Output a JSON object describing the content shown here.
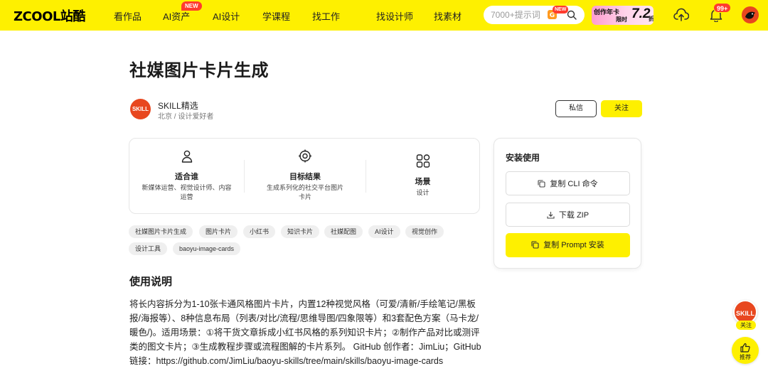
{
  "nav": {
    "logo": "ZCOOL站酷",
    "items": [
      {
        "label": "看作品",
        "badge": ""
      },
      {
        "label": "AI资产",
        "badge": "NEW"
      },
      {
        "label": "AI设计",
        "badge": ""
      },
      {
        "label": "学课程",
        "badge": ""
      },
      {
        "label": "找工作",
        "badge": ""
      },
      {
        "label": "找设计师",
        "badge": ""
      },
      {
        "label": "找素材",
        "badge": ""
      }
    ],
    "search_placeholder": "7000+提示词",
    "search_badge": "NEW",
    "promo": {
      "line1": "创作年卡",
      "line2": "限时",
      "price": "7.2",
      "unit": "折"
    },
    "notification_count": "99+"
  },
  "page": {
    "title": "社媒图片卡片生成"
  },
  "author": {
    "avatar_text": "SKILL",
    "name": "SKILL精选",
    "meta": "北京 / 设计爱好者",
    "dm_label": "私信",
    "follow_label": "关注"
  },
  "info": [
    {
      "icon": "user-icon",
      "label": "适合谁",
      "desc": "新媒体运营、视觉设计师、内容运营"
    },
    {
      "icon": "target-icon",
      "label": "目标结果",
      "desc": "生成系列化的社交平台图片卡片"
    },
    {
      "icon": "grid-icon",
      "label": "场景",
      "desc": "设计"
    }
  ],
  "tags": [
    "社媒图片卡片生成",
    "图片卡片",
    "小红书",
    "知识卡片",
    "社媒配图",
    "AI设计",
    "视觉创作",
    "设计工具",
    "baoyu-image-cards"
  ],
  "usage": {
    "title": "使用说明",
    "text": "将长内容拆分为1-10张卡通风格图片卡片，内置12种视觉风格（可爱/清新/手绘笔记/黑板报/海报等）、8种信息布局（列表/对比/流程/思维导图/四象限等）和3套配色方案（马卡龙/暖色/)。适用场景：①将干货文章拆成小红书风格的系列知识卡片；②制作产品对比或测评类的图文卡片；③生成教程步骤或流程图解的卡片系列。 GitHub 创作者：JimLiu；GitHub链接：https://github.com/JimLiu/baoyu-skills/tree/main/skills/baoyu-image-cards"
  },
  "install": {
    "title": "安装使用",
    "copy_cli": "复制 CLI 命令",
    "download_zip": "下载 ZIP",
    "copy_prompt": "复制 Prompt 安装"
  },
  "floating": {
    "skill_text": "SKILL",
    "follow_label": "关注",
    "recommend_label": "推荐"
  }
}
